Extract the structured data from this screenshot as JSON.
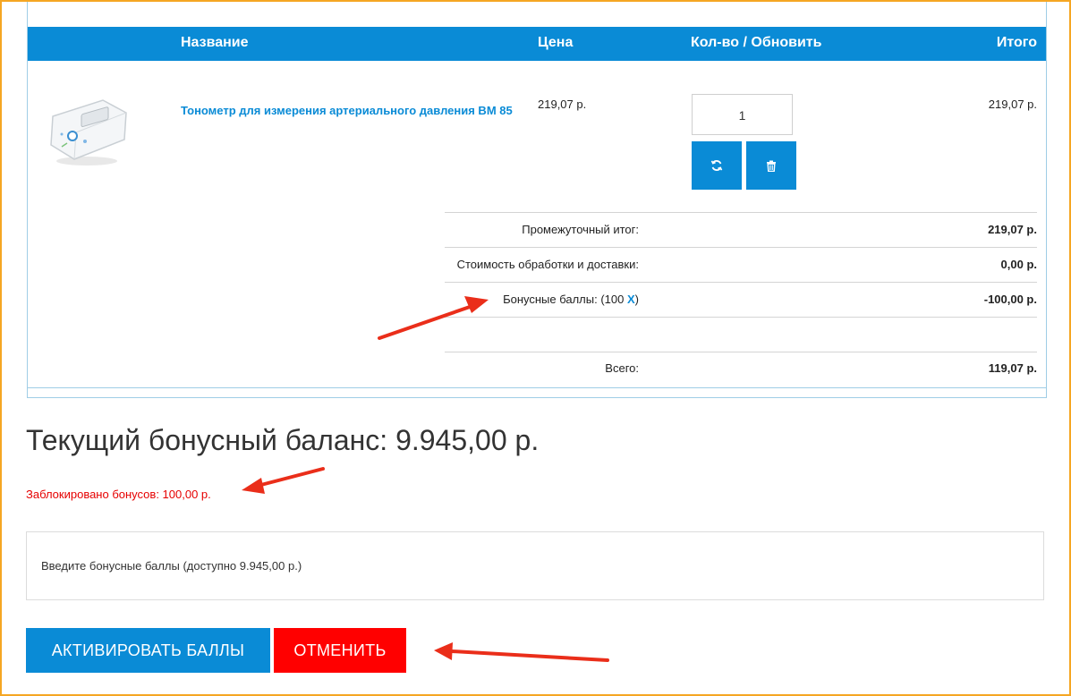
{
  "cart": {
    "headers": {
      "name": "Название",
      "price": "Цена",
      "qty": "Кол-во / Обновить",
      "total": "Итого"
    },
    "item": {
      "name": "Тонометр для измерения артериального давления BM 85",
      "price": "219,07 р.",
      "qty": "1",
      "total": "219,07 р."
    },
    "summary": {
      "subtotal_label": "Промежуточный итог:",
      "subtotal_value": "219,07 р.",
      "shipping_label": "Стоимость обработки и доставки:",
      "shipping_value": "0,00 р.",
      "bonus_label": "Бонусные баллы: (100",
      "bonus_remove": "X",
      "bonus_close": ")",
      "bonus_value": "-100,00 р.",
      "total_label": "Всего:",
      "total_value": "119,07 р."
    }
  },
  "bonus": {
    "balance": "Текущий бонусный баланс: 9.945,00 р.",
    "blocked": "Заблокировано бонусов: 100,00 р.",
    "input_placeholder": "Введите бонусные баллы (доступно 9.945,00 р.)",
    "activate_label": "АКТИВИРОВАТЬ БАЛЛЫ",
    "cancel_label": "ОТМЕНИТЬ"
  },
  "icons": {
    "refresh": "refresh-icon",
    "delete": "trash-icon",
    "product": "blood-pressure-monitor-image",
    "annotation": "red-arrow"
  },
  "colors": {
    "accent": "#0a8bd6",
    "danger": "#ff0000",
    "warning_text": "#e60000",
    "frame": "#f5a623"
  }
}
